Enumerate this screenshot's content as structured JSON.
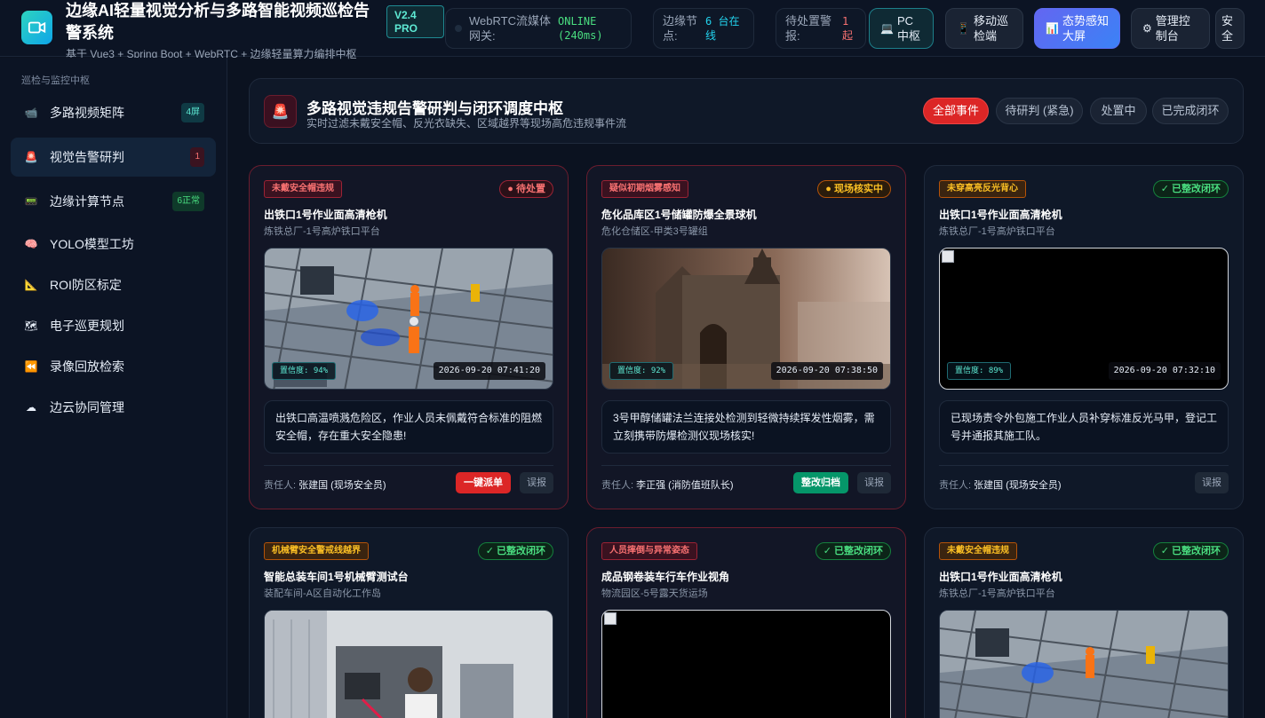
{
  "header": {
    "title": "边缘AI轻量视觉分析与多路智能视频巡检告警系统",
    "subtitle": "基于 Vue3 + Spring Boot + WebRTC + 边缘轻量算力编排中枢",
    "version": "V2.4 PRO",
    "stats": [
      {
        "label": "WebRTC流媒体网关:",
        "value": "ONLINE (240ms)",
        "color": "#4ade80"
      },
      {
        "label": "边缘节点:",
        "value": "6 台在线",
        "color": "#22d3ee"
      },
      {
        "label": "待处置警报:",
        "value": "1 起",
        "color": "#f87171"
      }
    ],
    "buttons": {
      "pc": "PC中枢",
      "mobile": "移动巡检端",
      "bigscreen": "态势感知大屏",
      "admin": "管理控制台",
      "safe": "安全"
    }
  },
  "sidebar": {
    "heading": "巡检与监控中枢",
    "items": [
      {
        "label": "多路视频矩阵",
        "icon": "camera-icon",
        "badge": "4屏"
      },
      {
        "label": "视觉告警研判",
        "icon": "siren-icon",
        "badge": "1"
      },
      {
        "label": "边缘计算节点",
        "icon": "server-icon",
        "badge": "6正常"
      },
      {
        "label": "YOLO模型工坊",
        "icon": "brain-icon",
        "badge": ""
      },
      {
        "label": "ROI防区标定",
        "icon": "ruler-icon",
        "badge": ""
      },
      {
        "label": "电子巡更规划",
        "icon": "map-icon",
        "badge": ""
      },
      {
        "label": "录像回放检索",
        "icon": "rewind-icon",
        "badge": ""
      },
      {
        "label": "边云协同管理",
        "icon": "cloud-icon",
        "badge": ""
      }
    ]
  },
  "banner": {
    "title": "多路视觉违规告警研判与闭环调度中枢",
    "subtitle": "实时过滤未戴安全帽、反光衣缺失、区域越界等现场高危违规事件流",
    "filters": [
      "全部事件",
      "待研判 (紧急)",
      "处置中",
      "已完成闭环"
    ]
  },
  "cards": [
    {
      "tag": "未戴安全帽违规",
      "status": "● 待处置",
      "title": "出铁口1号作业面高清枪机",
      "location": "炼铁总厂-1号高炉铁口平台",
      "confidence": "置信度: 94%",
      "timestamp": "2026-09-20 07:41:20",
      "description": "出铁口高温喷溅危险区，作业人员未佩戴符合标准的阻燃安全帽，存在重大安全隐患!",
      "owner_label": "责任人:",
      "owner": "张建国 (现场安全员)",
      "action": "一键派单",
      "secondary": "误报"
    },
    {
      "tag": "疑似初期烟雾感知",
      "status": "● 现场核实中",
      "title": "危化品库区1号储罐防爆全景球机",
      "location": "危化仓储区-甲类3号罐组",
      "confidence": "置信度: 92%",
      "timestamp": "2026-09-20 07:38:50",
      "description": "3号甲醇储罐法兰连接处检测到轻微持续挥发性烟雾，需立刻携带防爆检测仪现场核实!",
      "owner_label": "责任人:",
      "owner": "李正强 (消防值班队长)",
      "action": "整改归档",
      "secondary": "误报"
    },
    {
      "tag": "未穿高亮反光背心",
      "status": "✓ 已整改闭环",
      "title": "出铁口1号作业面高清枪机",
      "location": "炼铁总厂-1号高炉铁口平台",
      "confidence": "置信度: 89%",
      "timestamp": "2026-09-20 07:32:10",
      "description": "已现场责令外包施工作业人员补穿标准反光马甲，登记工号并通报其施工队。",
      "owner_label": "责任人:",
      "owner": "张建国 (现场安全员)",
      "action": "",
      "secondary": "误报"
    },
    {
      "tag": "机械臂安全警戒线越界",
      "status": "✓ 已整改闭环",
      "title": "智能总装车间1号机械臂测试台",
      "location": "装配车间-A区自动化工作岛"
    },
    {
      "tag": "人员摔倒与异常姿态",
      "status": "✓ 已整改闭环",
      "title": "成品钢卷装车行车作业视角",
      "location": "物流园区-5号露天货运场"
    },
    {
      "tag": "未戴安全帽违规",
      "status": "✓ 已整改闭环",
      "title": "出铁口1号作业面高清枪机",
      "location": "炼铁总厂-1号高炉铁口平台"
    }
  ]
}
